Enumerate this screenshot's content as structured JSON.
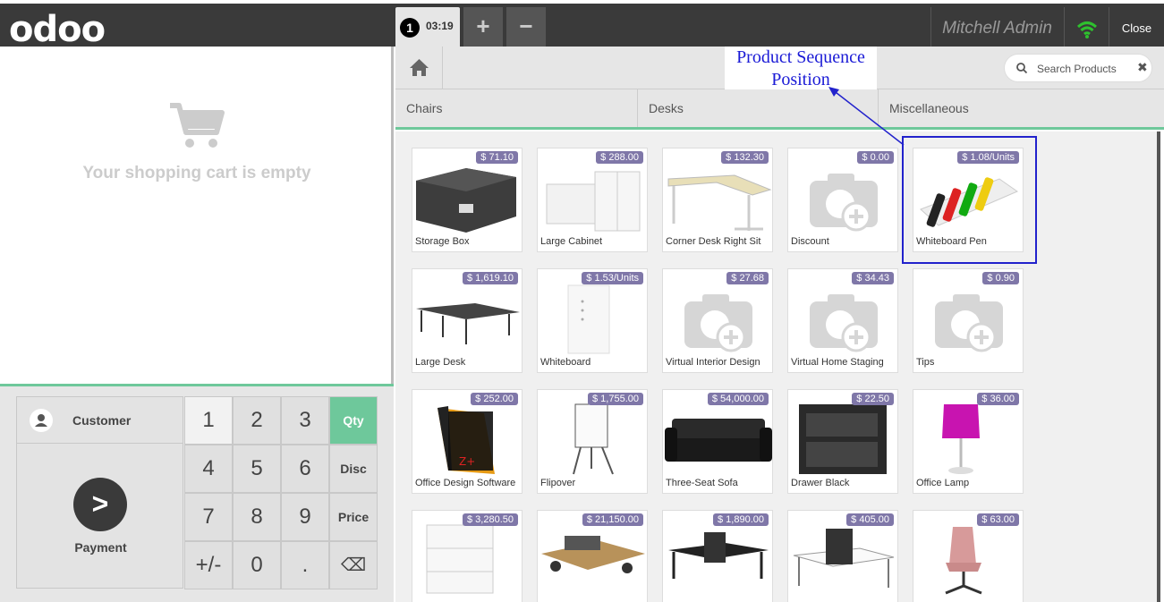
{
  "header": {
    "logo": "odoo",
    "order_number": "1",
    "order_time": "03:19",
    "add_order_label": "+",
    "remove_order_label": "−",
    "user_name": "Mitchell Admin",
    "close_label": "Close",
    "wifi_color": "#2ec12e"
  },
  "cart": {
    "empty_message": "Your shopping cart is empty"
  },
  "actionpad": {
    "customer_label": "Customer",
    "payment_label": "Payment",
    "payment_icon": ">"
  },
  "numpad": {
    "k1": "1",
    "k2": "2",
    "k3": "3",
    "qty": "Qty",
    "k4": "4",
    "k5": "5",
    "k6": "6",
    "disc": "Disc",
    "k7": "7",
    "k8": "8",
    "k9": "9",
    "price": "Price",
    "sign": "+/-",
    "k0": "0",
    "dot": ".",
    "backspace": "⌫"
  },
  "search": {
    "placeholder": "Search Products",
    "clear_icon": "✖"
  },
  "annotation": {
    "line1": "Product  Sequence",
    "line2": "Position"
  },
  "categories": [
    "Chairs",
    "Desks",
    "Miscellaneous"
  ],
  "accent_color": "#6ec89b",
  "products": [
    {
      "name": "Storage Box",
      "price": "$ 71.10"
    },
    {
      "name": "Large Cabinet",
      "price": "$ 288.00"
    },
    {
      "name": "Corner Desk Right Sit",
      "price": "$ 132.30"
    },
    {
      "name": "Discount",
      "price": "$ 0.00"
    },
    {
      "name": "Whiteboard Pen",
      "price": "$ 1.08/Units"
    },
    {
      "name": "Large Desk",
      "price": "$ 1,619.10"
    },
    {
      "name": "Whiteboard",
      "price": "$ 1.53/Units"
    },
    {
      "name": "Virtual Interior Design",
      "price": "$ 27.68"
    },
    {
      "name": "Virtual Home Staging",
      "price": "$ 34.43"
    },
    {
      "name": "Tips",
      "price": "$ 0.90"
    },
    {
      "name": "Office Design Software",
      "price": "$ 252.00"
    },
    {
      "name": "Flipover",
      "price": "$ 1,755.00"
    },
    {
      "name": "Three-Seat Sofa",
      "price": "$ 54,000.00"
    },
    {
      "name": "Drawer Black",
      "price": "$ 22.50"
    },
    {
      "name": "Office Lamp",
      "price": "$ 36.00"
    },
    {
      "name": "",
      "price": "$ 3,280.50"
    },
    {
      "name": "",
      "price": "$ 21,150.00"
    },
    {
      "name": "",
      "price": "$ 1,890.00"
    },
    {
      "name": "",
      "price": "$ 405.00"
    },
    {
      "name": "",
      "price": "$ 63.00"
    }
  ]
}
